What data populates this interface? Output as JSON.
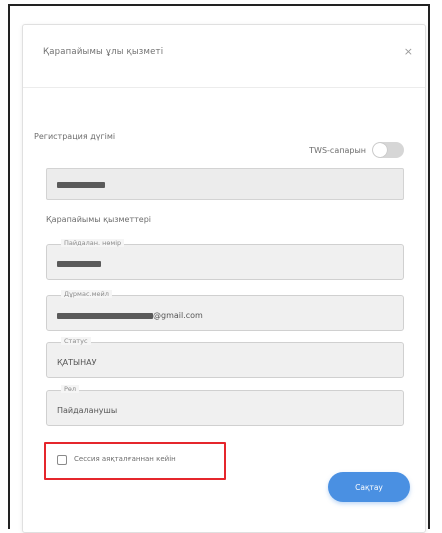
{
  "dialog": {
    "title": "Қарапайымы ұлы қызметі",
    "close_symbol": "×"
  },
  "registration": {
    "label": "Регистрация дүгімі",
    "twofa_label": "TWS-сапарын",
    "twofa_enabled": false
  },
  "section": {
    "label": "Қарапайымы қызметтері"
  },
  "fields": {
    "login": {
      "legend": "Пайдалан. нөмір"
    },
    "email": {
      "legend": "Дұрмас.мейл",
      "domain": "@gmail.com"
    },
    "status": {
      "legend": "Статус",
      "value": "ҚАТЫНАУ"
    },
    "role": {
      "legend": "Рөл",
      "value": "Пайдаланушы"
    }
  },
  "checkbox": {
    "label": "Сессия аяқталғаннан кейін",
    "checked": false
  },
  "buttons": {
    "save_label": "Сақтау"
  },
  "colors": {
    "accent": "#4a90e2",
    "highlight": "#e5262c",
    "field_bg": "#ececec"
  }
}
